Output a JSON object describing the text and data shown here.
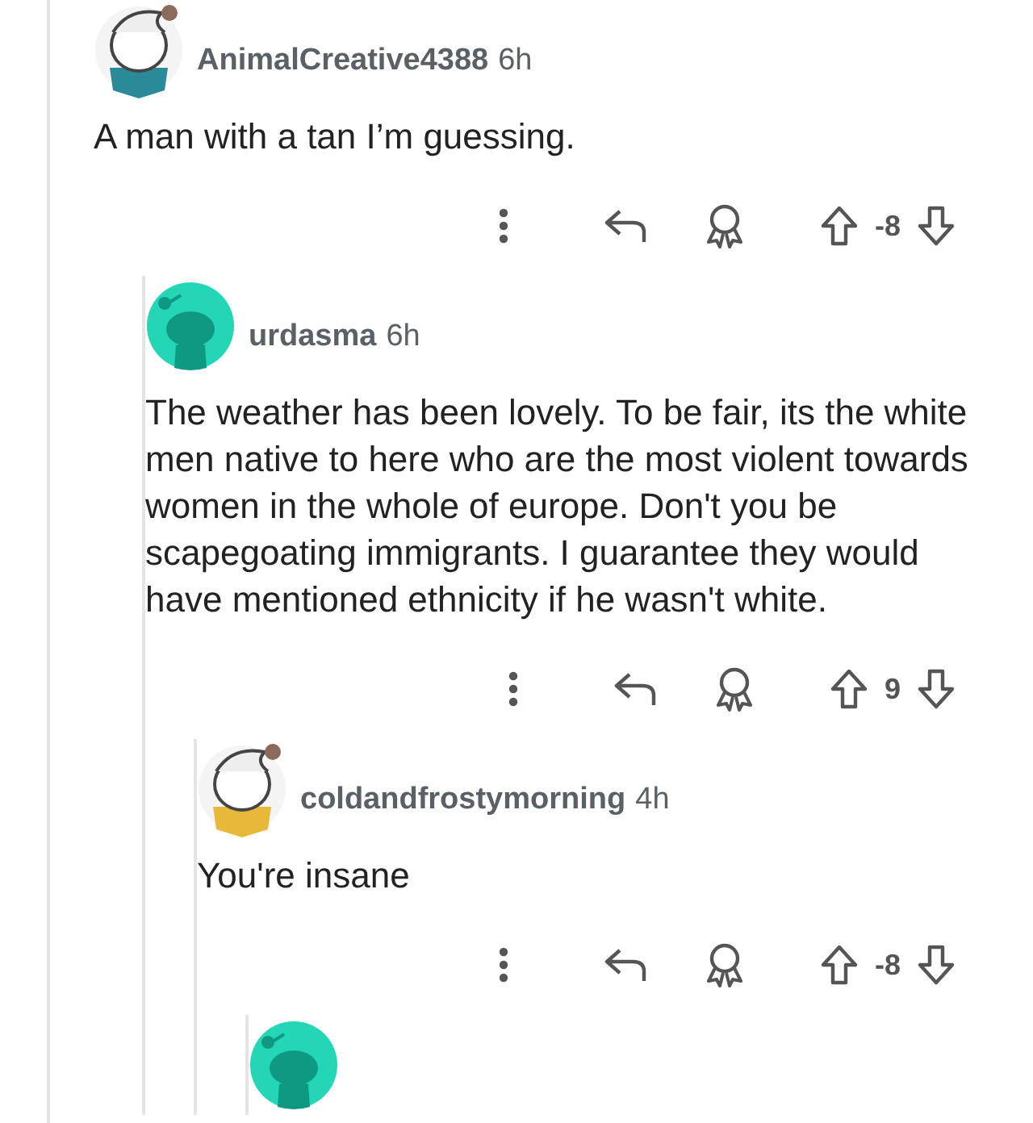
{
  "comments": [
    {
      "username": "AnimalCreative4388",
      "time": "6h",
      "avatar": {
        "kind": "custom",
        "color": "#2b8a98"
      },
      "text": "A man with a tan I’m guessing.",
      "score": "-8",
      "children": [
        {
          "username": "urdasma",
          "time": "6h",
          "avatar": {
            "kind": "snoo",
            "color": "#24d6b6"
          },
          "text": "The weather has been lovely. To be fair, its the white men native to here who are the most violent towards women in the whole of europe. Don't you be scapegoating immigrants. I guarantee they would have mentioned ethnicity if he wasn't white.",
          "score": "9",
          "children": [
            {
              "username": "coldandfrostymorning",
              "time": "4h",
              "avatar": {
                "kind": "custom",
                "color": "#e8b83a"
              },
              "text": "You're insane",
              "score": "-8",
              "children": [
                {
                  "avatar": {
                    "kind": "snoo",
                    "color": "#24d6b6"
                  }
                }
              ]
            }
          ]
        }
      ]
    }
  ]
}
